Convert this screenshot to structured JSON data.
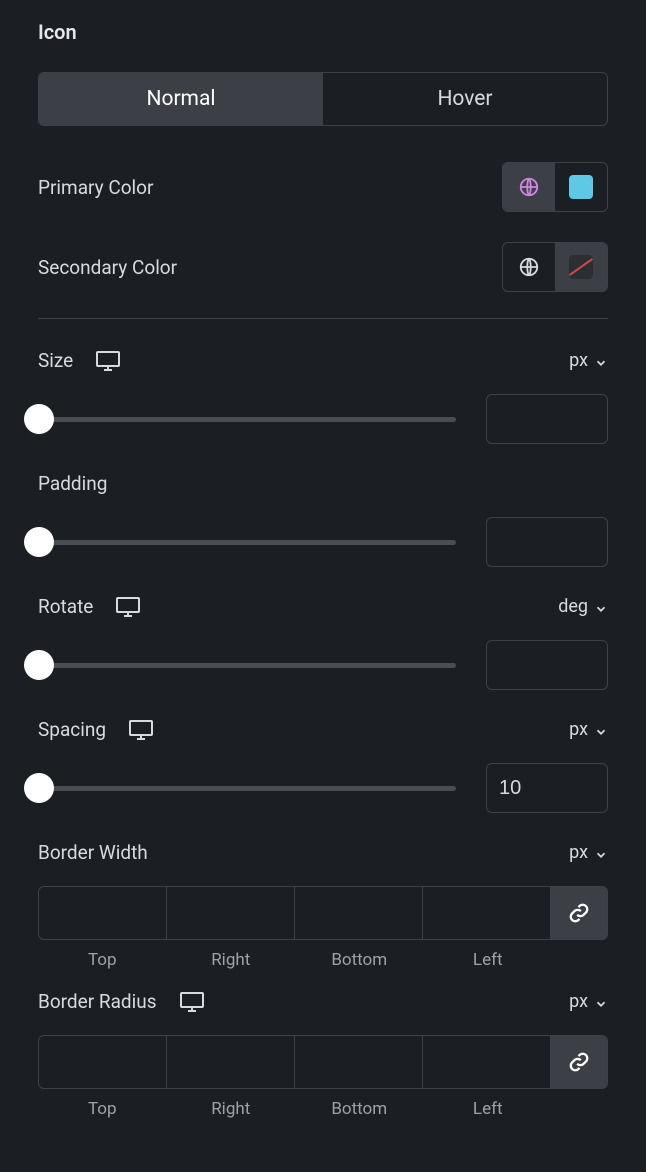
{
  "section": {
    "title": "Icon"
  },
  "tabs": {
    "normal": "Normal",
    "hover": "Hover"
  },
  "colors": {
    "primary": {
      "label": "Primary Color",
      "globe_active": true,
      "swatch": "#5fc8e6"
    },
    "secondary": {
      "label": "Secondary Color",
      "globe_active": false
    }
  },
  "size": {
    "label": "Size",
    "unit": "px",
    "value": ""
  },
  "padding": {
    "label": "Padding",
    "value": ""
  },
  "rotate": {
    "label": "Rotate",
    "unit": "deg",
    "value": ""
  },
  "spacing": {
    "label": "Spacing",
    "unit": "px",
    "value": "10"
  },
  "border_width": {
    "label": "Border Width",
    "unit": "px",
    "top": "",
    "right": "",
    "bottom": "",
    "left": "",
    "sides": {
      "top": "Top",
      "right": "Right",
      "bottom": "Bottom",
      "left": "Left"
    }
  },
  "border_radius": {
    "label": "Border Radius",
    "unit": "px",
    "top": "",
    "right": "",
    "bottom": "",
    "left": "",
    "sides": {
      "top": "Top",
      "right": "Right",
      "bottom": "Bottom",
      "left": "Left"
    }
  }
}
